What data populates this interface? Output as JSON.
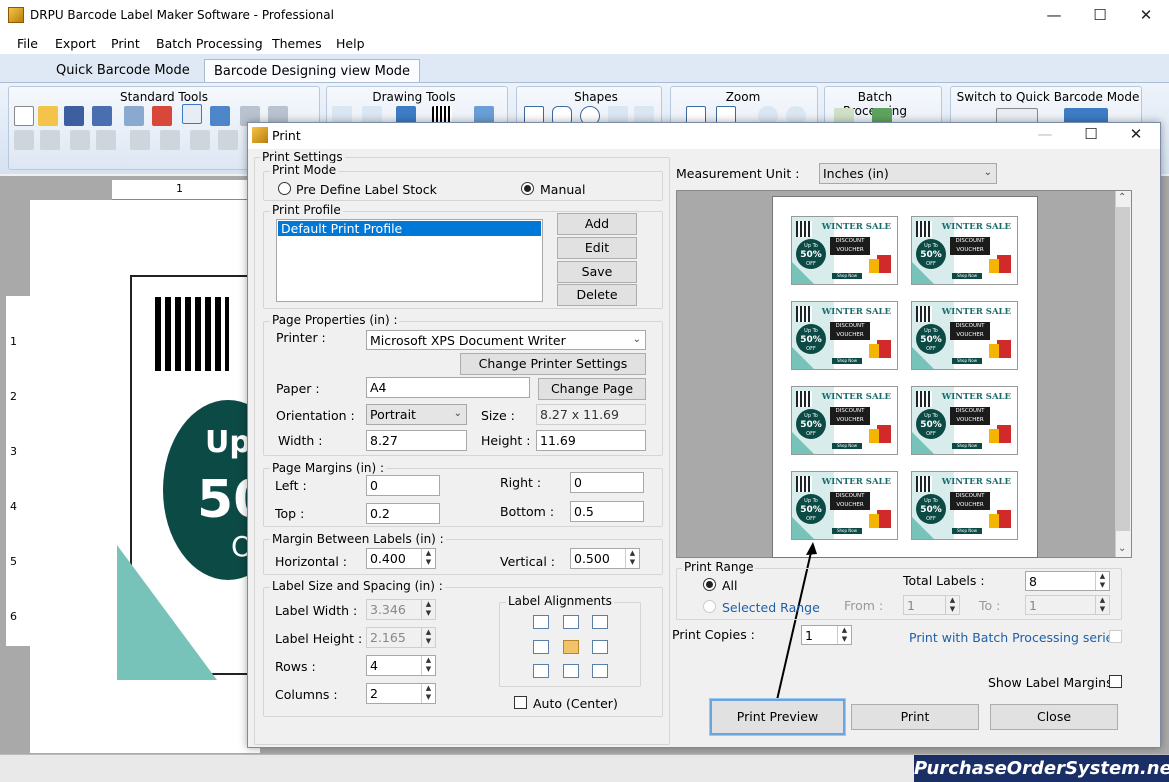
{
  "app": {
    "title": "DRPU Barcode Label Maker Software - Professional"
  },
  "menu": [
    "File",
    "Export",
    "Print",
    "Batch Processing",
    "Themes",
    "Help"
  ],
  "mode_tabs": [
    "Quick Barcode Mode",
    "Barcode Designing view Mode"
  ],
  "ribbon": {
    "standard_tools": "Standard Tools",
    "drawing_tools": "Drawing Tools",
    "shapes": "Shapes",
    "zoom": "Zoom",
    "batch_processing": "Batch Processing",
    "switch_mode": "Switch to Quick Barcode Mode"
  },
  "rulers": {
    "top": [
      "1"
    ],
    "left": [
      "1",
      "2",
      "3",
      "4",
      "5",
      "6"
    ]
  },
  "canvas_label": {
    "up": "Up",
    "pct": "50",
    "off": "O"
  },
  "dialog": {
    "title": "Print",
    "print_settings": "Print Settings",
    "print_mode": {
      "label": "Print Mode",
      "predefine": "Pre Define Label Stock",
      "manual": "Manual",
      "selected": "Manual"
    },
    "print_profile": {
      "label": "Print Profile",
      "items": [
        "Default Print Profile"
      ],
      "add": "Add",
      "edit": "Edit",
      "save": "Save",
      "delete": "Delete"
    },
    "page_properties": {
      "label": "Page Properties (in) :",
      "printer_label": "Printer :",
      "printer": "Microsoft XPS Document Writer",
      "change_printer": "Change Printer Settings",
      "paper_label": "Paper :",
      "paper": "A4",
      "change_page": "Change Page",
      "orientation_label": "Orientation :",
      "orientation": "Portrait",
      "size_label": "Size :",
      "size": "8.27 x 11.69",
      "width_label": "Width :",
      "width": "8.27",
      "height_label": "Height :",
      "height": "11.69"
    },
    "page_margins": {
      "label": "Page Margins (in) :",
      "left_label": "Left :",
      "left": "0",
      "right_label": "Right :",
      "right": "0",
      "top_label": "Top :",
      "top": "0.2",
      "bottom_label": "Bottom :",
      "bottom": "0.5"
    },
    "margin_between": {
      "label": "Margin Between Labels (in) :",
      "horizontal_label": "Horizontal :",
      "horizontal": "0.400",
      "vertical_label": "Vertical :",
      "vertical": "0.500"
    },
    "label_size": {
      "label": "Label Size and Spacing (in) :",
      "width_label": "Label Width :",
      "width": "3.346",
      "height_label": "Label Height :",
      "height": "2.165",
      "rows_label": "Rows :",
      "rows": "4",
      "columns_label": "Columns :",
      "columns": "2"
    },
    "alignments": {
      "label": "Label Alignments",
      "auto_center": "Auto (Center)"
    },
    "measurement": {
      "label": "Measurement Unit :",
      "value": "Inches (in)"
    },
    "preview_label": {
      "sale": "WINTER SALE",
      "upto": "Up To",
      "pct": "50%",
      "off": "OFF",
      "discount": "DISCOUNT",
      "voucher": "VOUCHER",
      "shop": "Shop Now"
    },
    "print_range": {
      "label": "Print Range",
      "all": "All",
      "selected_range": "Selected Range",
      "total_labels_label": "Total Labels :",
      "total_labels": "8",
      "from_label": "From :",
      "from": "1",
      "to_label": "To :",
      "to": "1"
    },
    "print_copies": {
      "label": "Print Copies :",
      "value": "1"
    },
    "batch_series": "Print with Batch Processing series",
    "show_margins": "Show Label Margins",
    "buttons": {
      "preview": "Print Preview",
      "print": "Print",
      "close": "Close"
    }
  },
  "watermark": "PurchaseOrderSystem.net"
}
